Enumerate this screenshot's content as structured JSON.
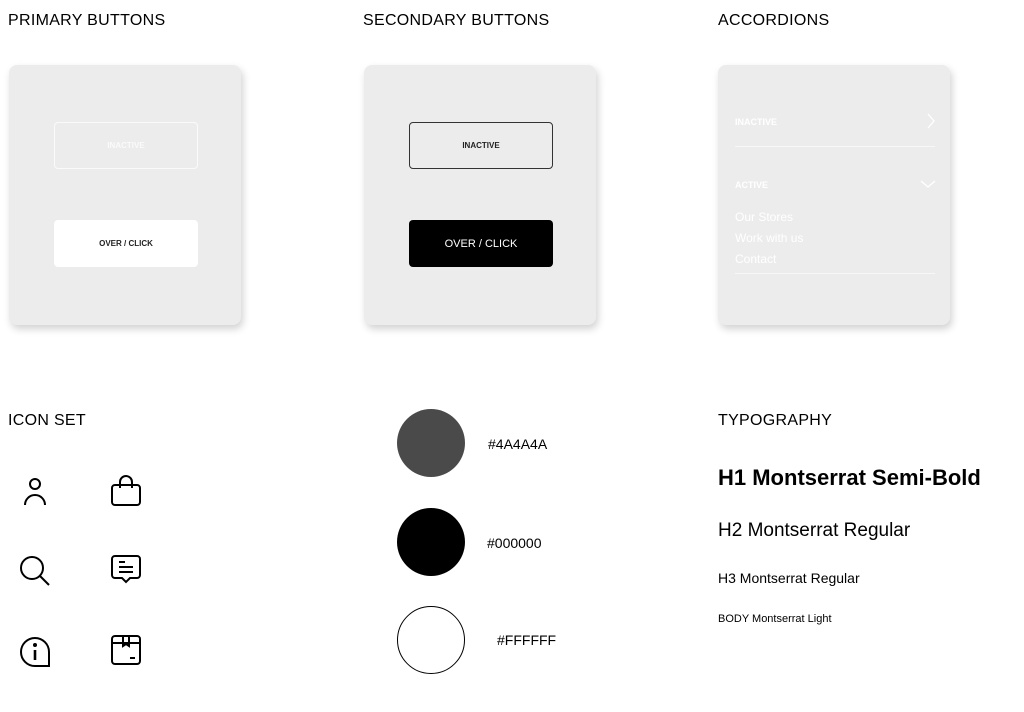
{
  "sections": {
    "primary": "PRIMARY BUTTONS",
    "secondary": "SECONDARY BUTTONS",
    "accordions": "ACCORDIONS",
    "icons": "ICON SET",
    "typography": "TYPOGRAPHY"
  },
  "primary": {
    "inactive": "INACTIVE",
    "hover": "OVER / CLICK"
  },
  "secondary": {
    "inactive": "INACTIVE",
    "hover": "OVER / CLICK"
  },
  "accordion": {
    "inactive": "INACTIVE",
    "active": "ACTIVE",
    "items": [
      "Our Stores",
      "Work with us",
      "Contact"
    ]
  },
  "icons": [
    "user-icon",
    "shopping-bag-icon",
    "search-icon",
    "message-icon",
    "info-icon",
    "package-icon"
  ],
  "colors": [
    {
      "hex": "#4A4A4A",
      "label": "#4A4A4A"
    },
    {
      "hex": "#000000",
      "label": "#000000"
    },
    {
      "hex": "#FFFFFF",
      "label": "#FFFFFF"
    }
  ],
  "typography": {
    "h1": "H1 Montserrat Semi-Bold",
    "h2": "H2 Montserrat Regular",
    "h3": "H3 Montserrat Regular",
    "body": "BODY Montserrat Light"
  }
}
